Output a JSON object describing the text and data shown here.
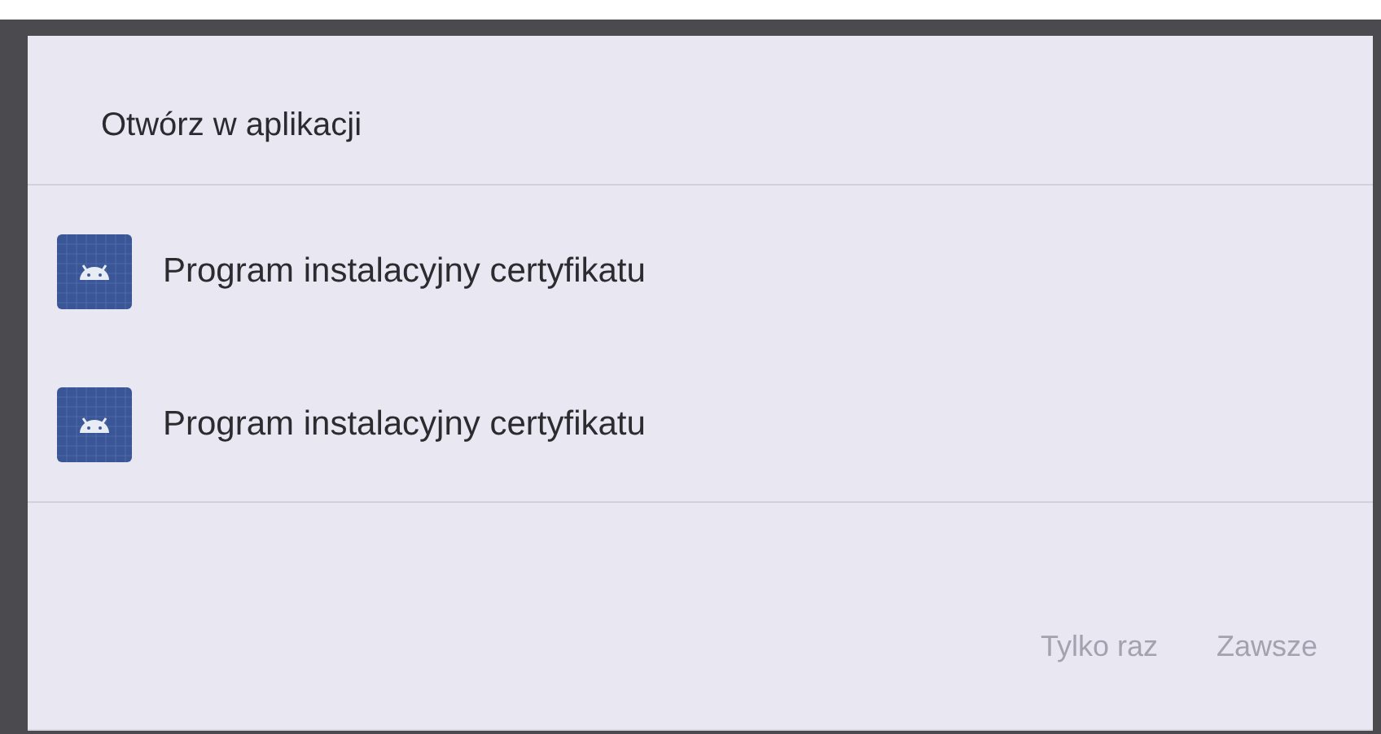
{
  "dialog": {
    "title": "Otwórz w aplikacji",
    "apps": [
      {
        "name": "Program instalacyjny certyfikatu"
      },
      {
        "name": "Program instalacyjny certyfikatu"
      }
    ],
    "buttons": [
      {
        "label": "Tylko raz",
        "disabled": true
      },
      {
        "label": "Zawsze",
        "disabled": true
      }
    ]
  }
}
